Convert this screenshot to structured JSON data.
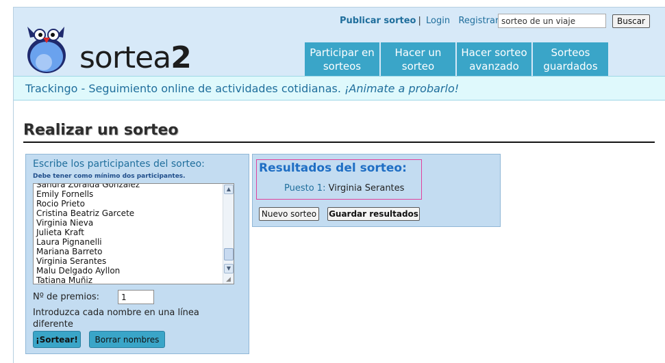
{
  "header": {
    "logo_text_light": "sortea",
    "logo_text_bold": "2",
    "logo_icon": "owl-mascot-icon",
    "links": {
      "publish": "Publicar sorteo",
      "separator": "|",
      "login": "Login",
      "register": "Registrar"
    },
    "search": {
      "value": "sorteo de un viaje",
      "button": "Buscar"
    },
    "nav": [
      {
        "line1": "Participar en",
        "line2": "sorteos"
      },
      {
        "line1": "Hacer un",
        "line2": "sorteo"
      },
      {
        "line1": "Hacer sorteo",
        "line2": "avanzado"
      },
      {
        "line1": "Sorteos",
        "line2": "guardados"
      }
    ]
  },
  "banner": {
    "text": "Trackingo - Seguimiento online de actividades cotidianas.",
    "cta": "¡Animate a probarlo!"
  },
  "page_title": "Realizar un sorteo",
  "participants": {
    "title": "Escribe los participantes del sorteo:",
    "subtitle": "Debe tener como mínimo dos participantes.",
    "names": [
      "Sandra Zoraida Gonzalez",
      "Emily Fornells",
      "Rocio Prieto",
      "Cristina Beatriz Garcete",
      "Virginia Nieva",
      "Julieta Kraft",
      "Laura Pignanelli",
      "Mariana Barreto",
      "Virginia Serantes",
      "Malu Delgado Ayllon",
      "Tatiana Muñiz"
    ],
    "scroll_up_icon": "arrow-up-icon",
    "scroll_down_icon": "arrow-down-icon",
    "prizes_label": "Nº de premios:",
    "prizes_value": "1",
    "hint": "Introduzca cada nombre en una línea diferente",
    "draw_button": "¡Sortear!",
    "clear_button": "Borrar nombres"
  },
  "results": {
    "title": "Resultados del sorteo:",
    "position_label": "Puesto 1:",
    "winner": "Virginia Serantes",
    "new_button": "Nuevo sorteo",
    "save_button": "Guardar resultados"
  },
  "colors": {
    "header_bg": "#d7e9f8",
    "nav_tab": "#3aa5c8",
    "panel_bg": "#c3dcf1",
    "link": "#1f6e9c",
    "results_border": "#e0409c"
  }
}
